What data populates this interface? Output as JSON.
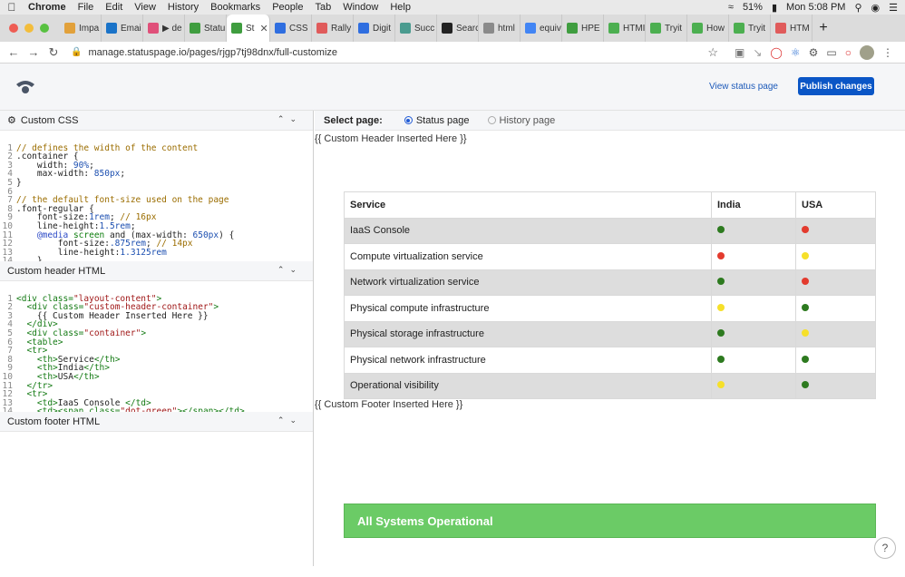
{
  "menubar": {
    "app": "Chrome",
    "items": [
      "File",
      "Edit",
      "View",
      "History",
      "Bookmarks",
      "People",
      "Tab",
      "Window",
      "Help"
    ],
    "battery": "51%",
    "clock": "Mon 5:08 PM"
  },
  "tabs": [
    {
      "label": "Impa",
      "color": "#e2a13b"
    },
    {
      "label": "Emai",
      "color": "#1a73c8"
    },
    {
      "label": "▶ de",
      "color": "#e0507a"
    },
    {
      "label": "Statu",
      "color": "#3f9d3f"
    },
    {
      "label": "St",
      "color": "#3f9d3f",
      "active": true
    },
    {
      "label": "CSS",
      "color": "#2f6ee0"
    },
    {
      "label": "Rally",
      "color": "#e05b5b"
    },
    {
      "label": "Digit",
      "color": "#2f6ee0"
    },
    {
      "label": "Succ",
      "color": "#4a9b8f"
    },
    {
      "label": "Searc",
      "color": "#222222"
    },
    {
      "label": "html",
      "color": "#8a8a8a"
    },
    {
      "label": "equiv",
      "color": "#4285f4"
    },
    {
      "label": "HPE",
      "color": "#3f9d3f"
    },
    {
      "label": "HTMI",
      "color": "#4caf50"
    },
    {
      "label": "Tryit",
      "color": "#4caf50"
    },
    {
      "label": "How",
      "color": "#4caf50"
    },
    {
      "label": "Tryit",
      "color": "#4caf50"
    },
    {
      "label": "HTM",
      "color": "#e05b5b"
    }
  ],
  "address": {
    "url": "manage.statuspage.io/pages/rjgp7tj98dnx/full-customize"
  },
  "header": {
    "view_status": "View status page",
    "publish": "Publish changes"
  },
  "left": {
    "css_title": "Custom CSS",
    "header_title": "Custom header HTML",
    "footer_title": "Custom footer HTML"
  },
  "right": {
    "select_label": "Select page:",
    "opt_status": "Status page",
    "opt_history": "History page",
    "custom_header": "{{ Custom Header Inserted Here }}",
    "custom_footer": "{{ Custom Footer Inserted Here }}",
    "table": {
      "headers": [
        "Service",
        "India",
        "USA"
      ],
      "rows": [
        {
          "service": "IaaS Console",
          "india": "green",
          "usa": "red"
        },
        {
          "service": "Compute virtualization service",
          "india": "red",
          "usa": "yellow"
        },
        {
          "service": "Network virtualization service",
          "india": "green",
          "usa": "red"
        },
        {
          "service": "Physical compute infrastructure",
          "india": "yellow",
          "usa": "green"
        },
        {
          "service": "Physical storage infrastructure",
          "india": "green",
          "usa": "yellow"
        },
        {
          "service": "Physical network infrastructure",
          "india": "green",
          "usa": "green"
        },
        {
          "service": "Operational visibility",
          "india": "yellow",
          "usa": "green"
        }
      ]
    },
    "all_ops": "All Systems Operational",
    "help": "?"
  },
  "colors": {
    "green": "#2d7a1f",
    "red": "#e33b2e",
    "yellow": "#f6e02a",
    "accent": "#0a56c6"
  }
}
